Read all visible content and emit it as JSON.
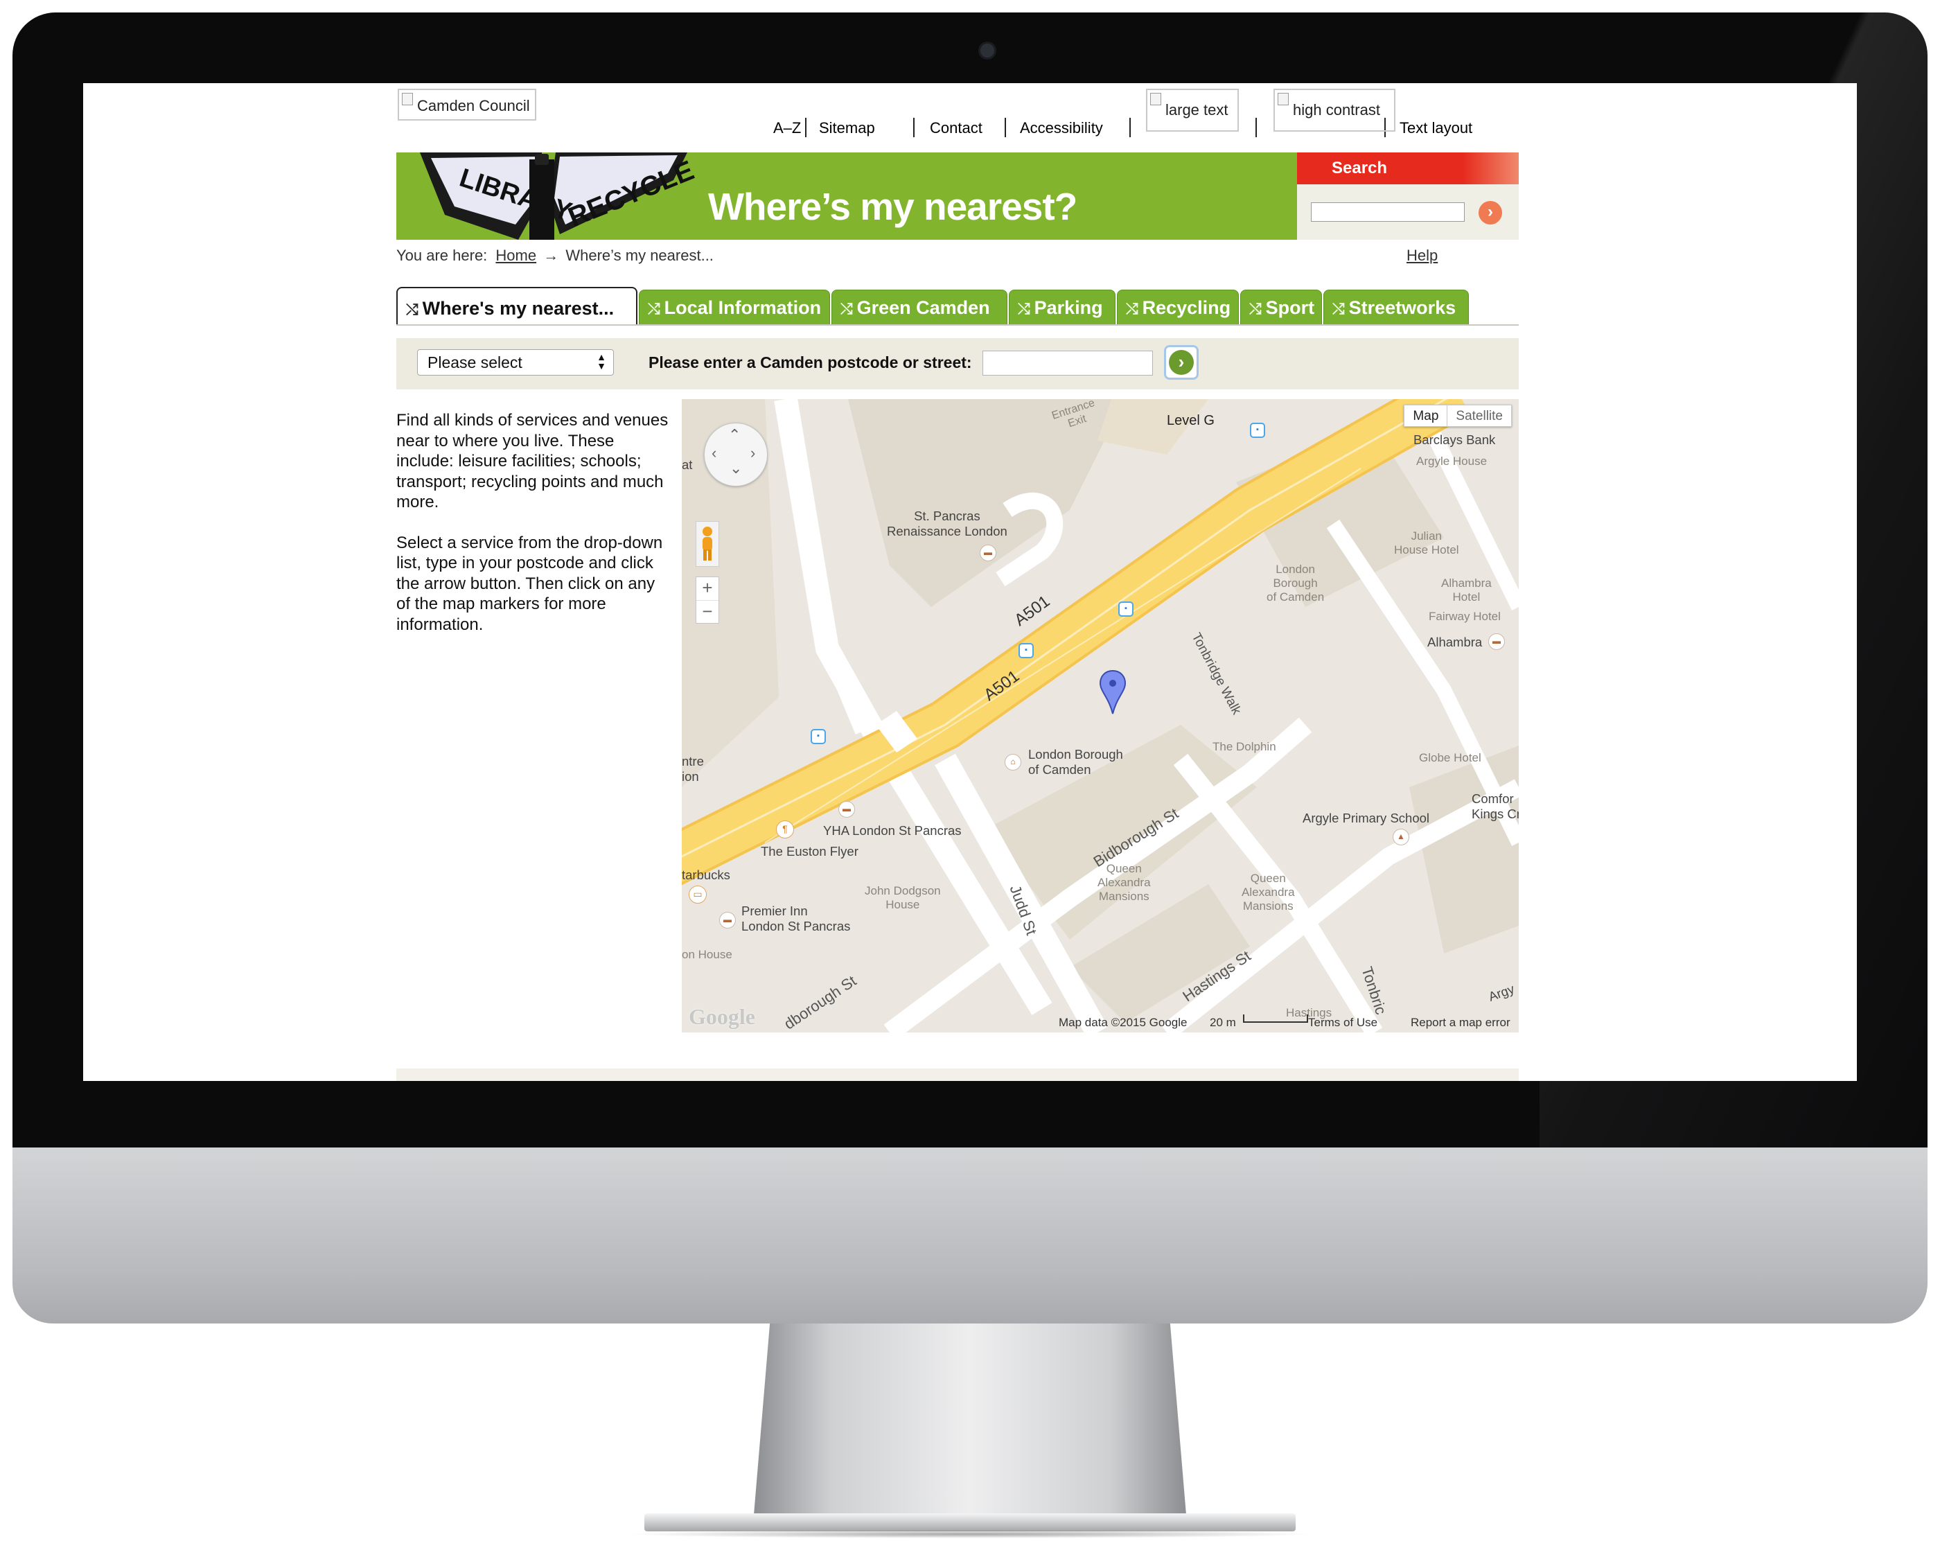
{
  "header": {
    "logo_alt": "Camden Council",
    "nav_links": [
      "A–Z",
      "Sitemap",
      "Contact",
      "Accessibility"
    ],
    "large_text_alt": "large text",
    "high_contrast_alt": "high contrast",
    "text_layout": "Text layout"
  },
  "banner": {
    "sign_left": "LIBRARY",
    "sign_right": "RECYCLE",
    "title": "Where’s my nearest?",
    "colors": {
      "banner": "#82b52d",
      "search_tab": "#e62b1e"
    }
  },
  "search": {
    "label": "Search",
    "value": "",
    "go_icon": "chevron-right-icon"
  },
  "breadcrumb": {
    "prefix": "You are here:",
    "home": "Home",
    "arrow": "→",
    "current": "Where’s my nearest..."
  },
  "help": "Help",
  "tabs": [
    {
      "label": "Where's my nearest...",
      "active": true
    },
    {
      "label": "Local Information"
    },
    {
      "label": "Green Camden"
    },
    {
      "label": "Parking"
    },
    {
      "label": "Recycling"
    },
    {
      "label": "Sport"
    },
    {
      "label": "Streetworks"
    }
  ],
  "finder": {
    "select_value": "Please select",
    "postcode_label": "Please enter a Camden postcode or street:",
    "postcode_value": ""
  },
  "intro": {
    "p1": "Find all kinds of services and venues near to where you live. These include: leisure facilities; schools; transport; recycling points and much more.",
    "p2": "Select a service from the drop-down list, type in your postcode and click the arrow button. Then click on any of the map markers for more information."
  },
  "map": {
    "type_map": "Map",
    "type_satellite": "Satellite",
    "zoom_in": "+",
    "zoom_out": "−",
    "labels": {
      "entrance_exit": "Entrance\nExit",
      "level_g": "Level G",
      "barclays": "Barclays Bank",
      "argyle_house": "Argyle House",
      "julian": "Julian\nHouse Hotel",
      "alhambra_hotel": "Alhambra\nHotel",
      "fairway": "Fairway Hotel",
      "alhambra": "Alhambra",
      "st_pancras": "St. Pancras\nRenaissance London",
      "lbc_gray": "London\nBorough\nof Camden",
      "tonbridge_walk": "Tonbridge Walk",
      "a501_top": "A501",
      "a501_bottom": "A501",
      "at": "at",
      "centre_fragment": "ntre\nion",
      "the_dolphin": "The Dolphin",
      "globe": "Globe Hotel",
      "lbc": "London Borough\nof Camden",
      "bidborough": "Bidborough St",
      "comfort": "Comfor\nKings Cros",
      "argyle_school": "Argyle Primary School",
      "yha": "YHA London St Pancras",
      "euston_flyer": "The Euston Flyer",
      "starbucks": "tarbucks",
      "john_dodgson": "John Dodgson\nHouse",
      "premier_inn": "Premier Inn\nLondon St Pancras",
      "queen_alex_1": "Queen\nAlexandra\nMansions",
      "queen_alex_2": "Queen\nAlexandra\nMansions",
      "judd": "Judd St",
      "hastings_st": "Hastings St",
      "hastings": "Hastings",
      "on_house": "on House",
      "tonbridge": "Tonbric",
      "argyle_fragment": "Argy",
      "bidborough_frag": "dborough St"
    },
    "footer": {
      "google": "Google",
      "map_data": "Map data ©2015 Google",
      "scale": "20 m",
      "terms": "Terms of Use",
      "report": "Report a map error"
    }
  }
}
